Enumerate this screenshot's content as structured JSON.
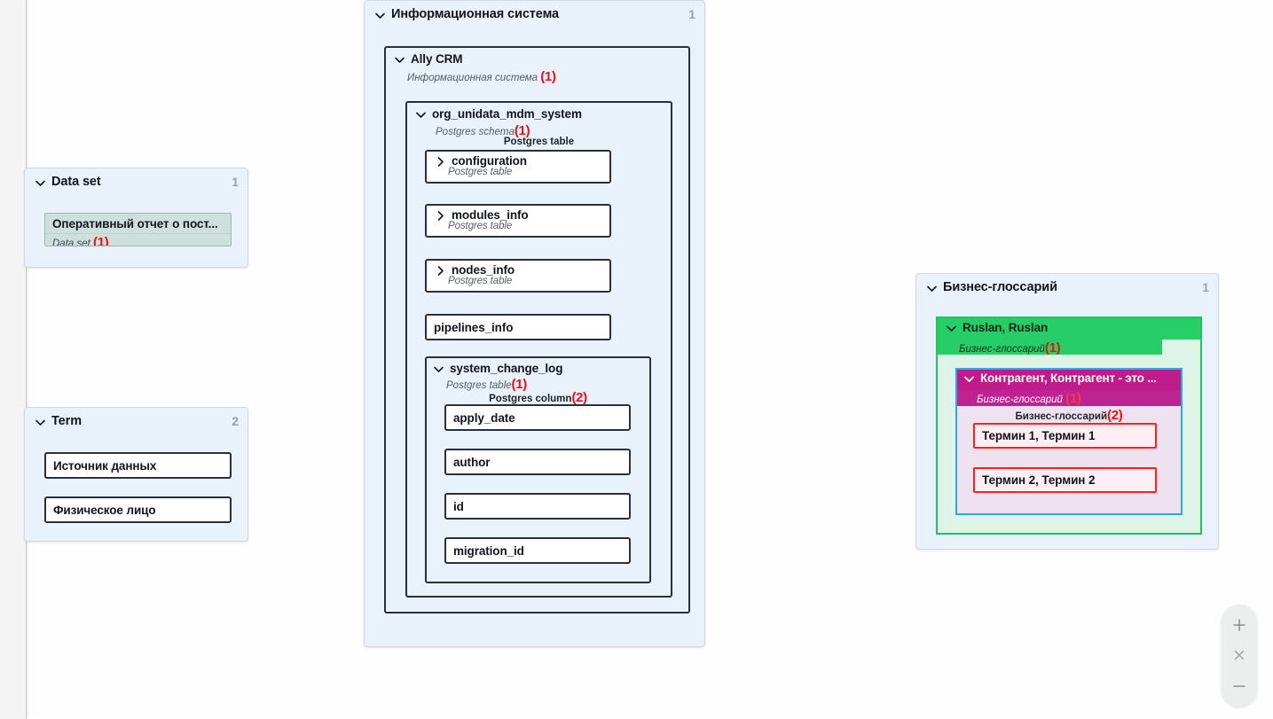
{
  "canvas": {
    "background_color": "#fefefe",
    "accent_red": "#e8110f",
    "panel_blue": "#e9f1fb",
    "green": "#27cd66",
    "magenta": "#bf1b8a",
    "blue_outline": "#29abe2"
  },
  "groups": {
    "dataset": {
      "title": "Data set",
      "count": "1",
      "chevron_icon": "chevron-down-icon",
      "card": {
        "title": "Оперативный отчет о пост...",
        "subtitle": "Data set",
        "count": "(1)"
      }
    },
    "term": {
      "title": "Term",
      "count": "2",
      "chevron_icon": "chevron-down-icon",
      "items": [
        {
          "label": "Источник данных"
        },
        {
          "label": "Физическое лицо"
        }
      ]
    },
    "info_system": {
      "title": "Информационная система",
      "count": "1",
      "chevron_icon": "chevron-down-icon",
      "system": {
        "title": "Ally CRM",
        "subtitle": "Информационная система",
        "count": "(1)",
        "chevron_icon": "chevron-down-icon",
        "schema": {
          "title": "org_unidata_mdm_system",
          "subtitle": "Postgres schema",
          "count": "(1)",
          "chevron_icon": "chevron-down-icon",
          "child_type_label": "Postgres table",
          "tables": [
            {
              "title": "configuration",
              "subtitle": "Postgres table",
              "chevron_icon": "chevron-right-icon"
            },
            {
              "title": "modules_info",
              "subtitle": "Postgres table",
              "chevron_icon": "chevron-right-icon"
            },
            {
              "title": "nodes_info",
              "subtitle": "Postgres table",
              "chevron_icon": "chevron-right-icon"
            },
            {
              "title": "pipelines_info",
              "subtitle": "",
              "chevron_icon": ""
            }
          ],
          "expanded_table": {
            "title": "system_change_log",
            "subtitle": "Postgres table",
            "count": "(1)",
            "chevron_icon": "chevron-down-icon",
            "child_type_label": "Postgres column",
            "child_type_count": "(2)",
            "columns": [
              {
                "label": "apply_date"
              },
              {
                "label": "author"
              },
              {
                "label": "id"
              },
              {
                "label": "migration_id"
              }
            ]
          }
        }
      }
    },
    "glossary": {
      "title": "Бизнес-глоссарий",
      "count": "1",
      "chevron_icon": "chevron-down-icon",
      "root": {
        "title": "Ruslan, Ruslan",
        "subtitle": "Бизнес-глоссарий",
        "count": "(1)",
        "chevron_icon": "chevron-down-icon",
        "child": {
          "title": "Контрагент, Контрагент - это ...",
          "subtitle": "Бизнес-глоссарий",
          "count": "(1)",
          "chevron_icon": "chevron-down-icon",
          "child_type_label": "Бизнес-глоссарий",
          "child_type_count": "(2)",
          "terms": [
            {
              "label": "Термин 1, Термин 1"
            },
            {
              "label": "Термин 2, Термин 2"
            }
          ]
        }
      }
    }
  },
  "zoom_control": {
    "zoom_in_icon": "plus-icon",
    "reset_icon": "close-icon",
    "zoom_out_icon": "minus-icon"
  }
}
